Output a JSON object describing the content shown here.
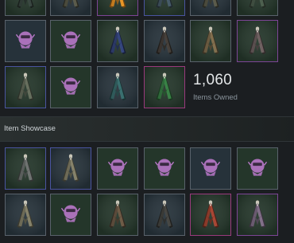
{
  "collection": {
    "items_owned_count": "1,060",
    "items_owned_label": "Items Owned"
  },
  "showcase": {
    "title": "Item Showcase"
  },
  "colors": {
    "tile_green_bg": "#24362a",
    "tile_slate_bg": "#26323a",
    "border_default": "#59626b",
    "border_blue": "#4a54a0",
    "border_purple": "#7d4596",
    "border_pink": "#9a3a7d",
    "locked_icon": "#b978c9"
  },
  "collection_grid": [
    {
      "row": 0,
      "col": 0,
      "kind": "cape",
      "cape_color": "#2f3a35",
      "rarity": "common"
    },
    {
      "row": 0,
      "col": 1,
      "kind": "cape",
      "cape_color": "#4a4a3c",
      "rarity": "common"
    },
    {
      "row": 0,
      "col": 2,
      "kind": "cape",
      "cape_color": "#c27a1f",
      "rarity": "epic"
    },
    {
      "row": 0,
      "col": 3,
      "kind": "cape",
      "cape_color": "#3a4a55",
      "rarity": "rare"
    },
    {
      "row": 0,
      "col": 4,
      "kind": "cape",
      "cape_color": "#4a4a3c",
      "rarity": "common"
    },
    {
      "row": 0,
      "col": 5,
      "kind": "cape",
      "cape_color": "#3f4d40",
      "rarity": "common"
    },
    {
      "row": 1,
      "col": 0,
      "kind": "locked",
      "rarity": "common"
    },
    {
      "row": 1,
      "col": 1,
      "kind": "locked",
      "rarity": "common"
    },
    {
      "row": 1,
      "col": 2,
      "kind": "cape",
      "cape_color": "#2b3866",
      "rarity": "common"
    },
    {
      "row": 1,
      "col": 3,
      "kind": "cape",
      "cape_color": "#3a3430",
      "rarity": "common"
    },
    {
      "row": 1,
      "col": 4,
      "kind": "cape",
      "cape_color": "#6a5a40",
      "rarity": "common"
    },
    {
      "row": 1,
      "col": 5,
      "kind": "cape",
      "cape_color": "#5a4f4f",
      "rarity": "epic"
    },
    {
      "row": 2,
      "col": 0,
      "kind": "cape",
      "cape_color": "#545a4c",
      "rarity": "rare"
    },
    {
      "row": 2,
      "col": 1,
      "kind": "locked",
      "rarity": "common"
    },
    {
      "row": 2,
      "col": 2,
      "kind": "cape",
      "cape_color": "#2f5a5a",
      "rarity": "common"
    },
    {
      "row": 2,
      "col": 3,
      "kind": "cape",
      "cape_color": "#2f6a3a",
      "rarity": "legendary"
    }
  ],
  "showcase_grid": [
    {
      "row": 0,
      "col": 0,
      "kind": "cape",
      "cape_color": "#5a5e5c",
      "rarity": "rare"
    },
    {
      "row": 0,
      "col": 1,
      "kind": "cape",
      "cape_color": "#6d6a56",
      "rarity": "rare"
    },
    {
      "row": 0,
      "col": 2,
      "kind": "locked",
      "rarity": "common"
    },
    {
      "row": 0,
      "col": 3,
      "kind": "locked",
      "rarity": "common"
    },
    {
      "row": 0,
      "col": 4,
      "kind": "locked",
      "rarity": "common"
    },
    {
      "row": 0,
      "col": 5,
      "kind": "locked",
      "rarity": "common"
    },
    {
      "row": 1,
      "col": 0,
      "kind": "cape",
      "cape_color": "#6d6a56",
      "rarity": "common"
    },
    {
      "row": 1,
      "col": 1,
      "kind": "locked",
      "rarity": "common"
    },
    {
      "row": 1,
      "col": 2,
      "kind": "cape",
      "cape_color": "#5a4a3a",
      "rarity": "common"
    },
    {
      "row": 1,
      "col": 3,
      "kind": "cape",
      "cape_color": "#3a3a36",
      "rarity": "common"
    },
    {
      "row": 1,
      "col": 4,
      "kind": "cape",
      "cape_color": "#8a3a2a",
      "rarity": "legendary"
    },
    {
      "row": 1,
      "col": 5,
      "kind": "cape",
      "cape_color": "#6a5a70",
      "rarity": "epic"
    }
  ]
}
